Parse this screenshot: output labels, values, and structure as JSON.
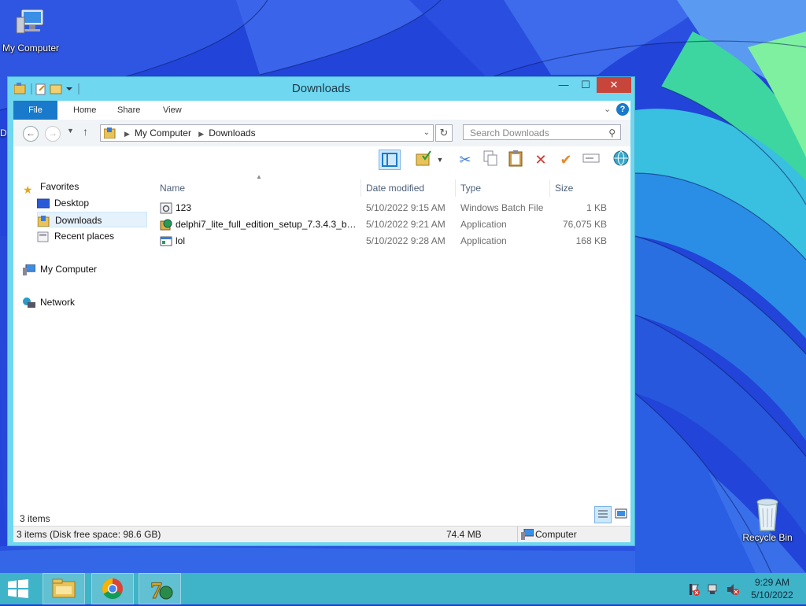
{
  "desktop": {
    "icons": [
      {
        "label": "My Computer",
        "icon": "computer-icon"
      },
      {
        "label": "Recycle Bin",
        "icon": "recycle-bin-icon"
      }
    ],
    "edge_fragment": "D"
  },
  "window": {
    "title": "Downloads",
    "controls": {
      "minimize": "—",
      "maximize": "☐",
      "close": "✕"
    },
    "ribbon_tabs": [
      "File",
      "Home",
      "Share",
      "View"
    ],
    "address": {
      "crumbs": [
        "My Computer",
        "Downloads"
      ]
    },
    "search": {
      "placeholder": "Search Downloads"
    },
    "navigation": {
      "favorites_label": "Favorites",
      "favorites": [
        "Desktop",
        "Downloads",
        "Recent places"
      ],
      "selected": "Downloads",
      "my_computer": "My Computer",
      "network": "Network"
    },
    "columns": [
      "Name",
      "Date modified",
      "Type",
      "Size"
    ],
    "files": [
      {
        "name": "123",
        "date": "5/10/2022 9:15 AM",
        "type": "Windows Batch File",
        "size": "1 KB",
        "icon": "batch-file-icon"
      },
      {
        "name": "delphi7_lite_full_edition_setup_7.3.4.3_bu...",
        "date": "5/10/2022 9:21 AM",
        "type": "Application",
        "size": "76,075 KB",
        "icon": "setup-app-icon"
      },
      {
        "name": "lol",
        "date": "5/10/2022 9:28 AM",
        "type": "Application",
        "size": "168 KB",
        "icon": "app-icon"
      }
    ],
    "item_count": "3 items",
    "statusbar": {
      "disk": "3 items (Disk free space: 98.6 GB)",
      "size": "74.4 MB",
      "zone": "Computer"
    }
  },
  "taskbar": {
    "apps": [
      "file-explorer-icon",
      "chrome-icon",
      "delphi-icon"
    ],
    "time": "9:29 AM",
    "date": "5/10/2022"
  },
  "colors": {
    "window_frame": "#6fd7f0",
    "ribbon_file": "#1979ca",
    "close_button": "#c7453a",
    "taskbar": "#3fb3c8"
  }
}
